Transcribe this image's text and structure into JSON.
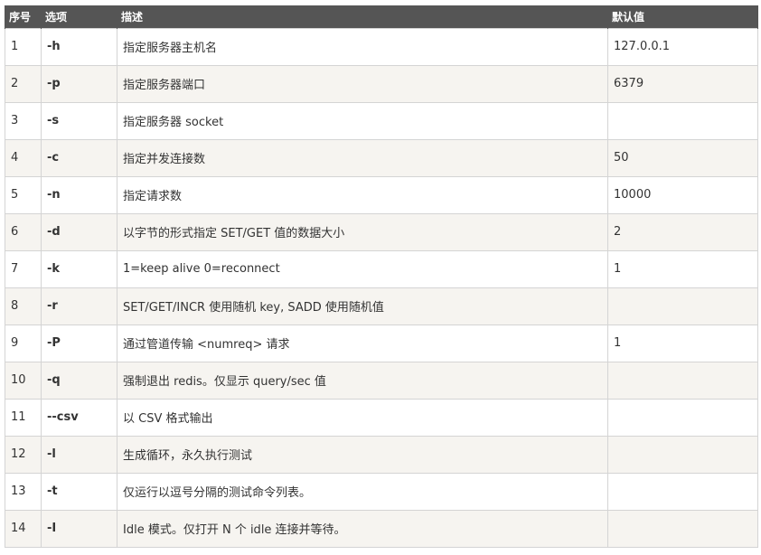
{
  "table": {
    "headers": [
      "序号",
      "选项",
      "描述",
      "默认值"
    ],
    "rows": [
      {
        "num": "1",
        "option": "-h",
        "description": "指定服务器主机名",
        "default": "127.0.0.1"
      },
      {
        "num": "2",
        "option": "-p",
        "description": "指定服务器端口",
        "default": "6379"
      },
      {
        "num": "3",
        "option": "-s",
        "description": "指定服务器 socket",
        "default": ""
      },
      {
        "num": "4",
        "option": "-c",
        "description": "指定并发连接数",
        "default": "50"
      },
      {
        "num": "5",
        "option": "-n",
        "description": "指定请求数",
        "default": "10000"
      },
      {
        "num": "6",
        "option": "-d",
        "description": "以字节的形式指定 SET/GET 值的数据大小",
        "default": "2"
      },
      {
        "num": "7",
        "option": "-k",
        "description": "1=keep alive 0=reconnect",
        "default": "1"
      },
      {
        "num": "8",
        "option": "-r",
        "description": "SET/GET/INCR 使用随机 key, SADD 使用随机值",
        "default": ""
      },
      {
        "num": "9",
        "option": "-P",
        "description": "通过管道传输 <numreq> 请求",
        "default": "1"
      },
      {
        "num": "10",
        "option": "-q",
        "description": "强制退出 redis。仅显示 query/sec 值",
        "default": ""
      },
      {
        "num": "11",
        "option": "--csv",
        "description": "以 CSV 格式输出",
        "default": ""
      },
      {
        "num": "12",
        "option": "-l",
        "description": "生成循环，永久执行测试",
        "default": ""
      },
      {
        "num": "13",
        "option": "-t",
        "description": "仅运行以逗号分隔的测试命令列表。",
        "default": ""
      },
      {
        "num": "14",
        "option": "-I",
        "description": "Idle 模式。仅打开 N 个 idle 连接并等待。",
        "default": ""
      }
    ]
  }
}
